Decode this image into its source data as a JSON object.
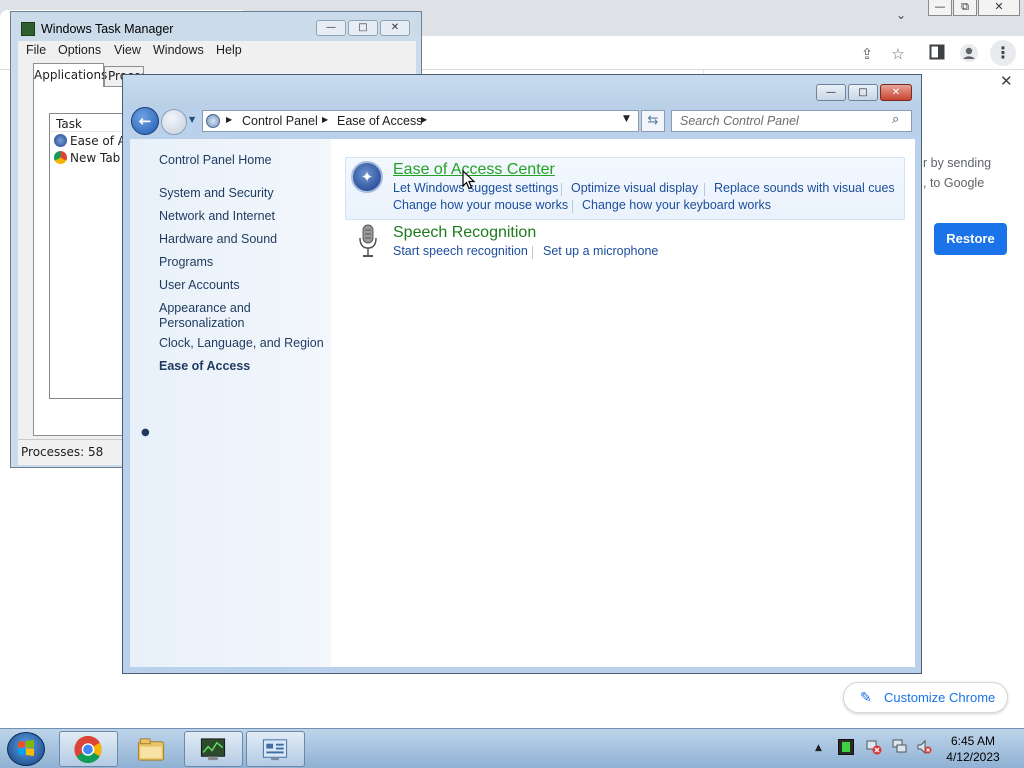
{
  "chrome": {
    "window_controls": {
      "minimize": "—",
      "restore": "⧉",
      "close": "✕"
    },
    "side_panel": {
      "close_icon": "✕",
      "text_line1": "r by sending",
      "text_line2": ", to Google",
      "restore_label": "Restore"
    },
    "customize_label": "Customize Chrome",
    "icons": [
      "share-icon",
      "star-icon",
      "side-panel-icon",
      "profile-icon",
      "menu-dots-icon",
      "tab-search-chevron-icon",
      "edit-pencil-icon"
    ]
  },
  "task_manager": {
    "title": "Windows Task Manager",
    "menu": [
      "File",
      "Options",
      "View",
      "Windows",
      "Help"
    ],
    "tabs": [
      "Applications",
      "Processes"
    ],
    "column_task": "Task",
    "rows": [
      "Ease of Access",
      "New Tab - Google Chrome"
    ],
    "status": "Processes: 58"
  },
  "control_panel": {
    "breadcrumb": [
      "Control Panel",
      "Ease of Access"
    ],
    "search_placeholder": "Search Control Panel",
    "nav": {
      "home": "Control Panel Home",
      "items": [
        "System and Security",
        "Network and Internet",
        "Hardware and Sound",
        "Programs",
        "User Accounts",
        "Appearance and",
        "Personalization",
        "Clock, Language, and Region",
        "Ease of Access"
      ]
    },
    "categories": [
      {
        "title": "Ease of Access Center",
        "links": [
          "Let Windows suggest settings",
          "Optimize visual display",
          "Replace sounds with visual cues",
          "Change how your mouse works",
          "Change how your keyboard works"
        ]
      },
      {
        "title": "Speech Recognition",
        "links": [
          "Start speech recognition",
          "Set up a microphone"
        ]
      }
    ]
  },
  "taskbar": {
    "pinned": [
      "chrome-icon",
      "explorer-folder-icon",
      "task-manager-icon",
      "control-panel-icon"
    ],
    "time": "6:45 AM",
    "date": "4/12/2023",
    "tray_icons": [
      "show-hidden-icons",
      "battery-icon",
      "network-error-icon",
      "action-center-icon",
      "volume-muted-icon"
    ]
  },
  "colors": {
    "link": "#1c4e9c",
    "category_title": "#1e7a1e",
    "chrome_accent": "#1a73e8"
  }
}
